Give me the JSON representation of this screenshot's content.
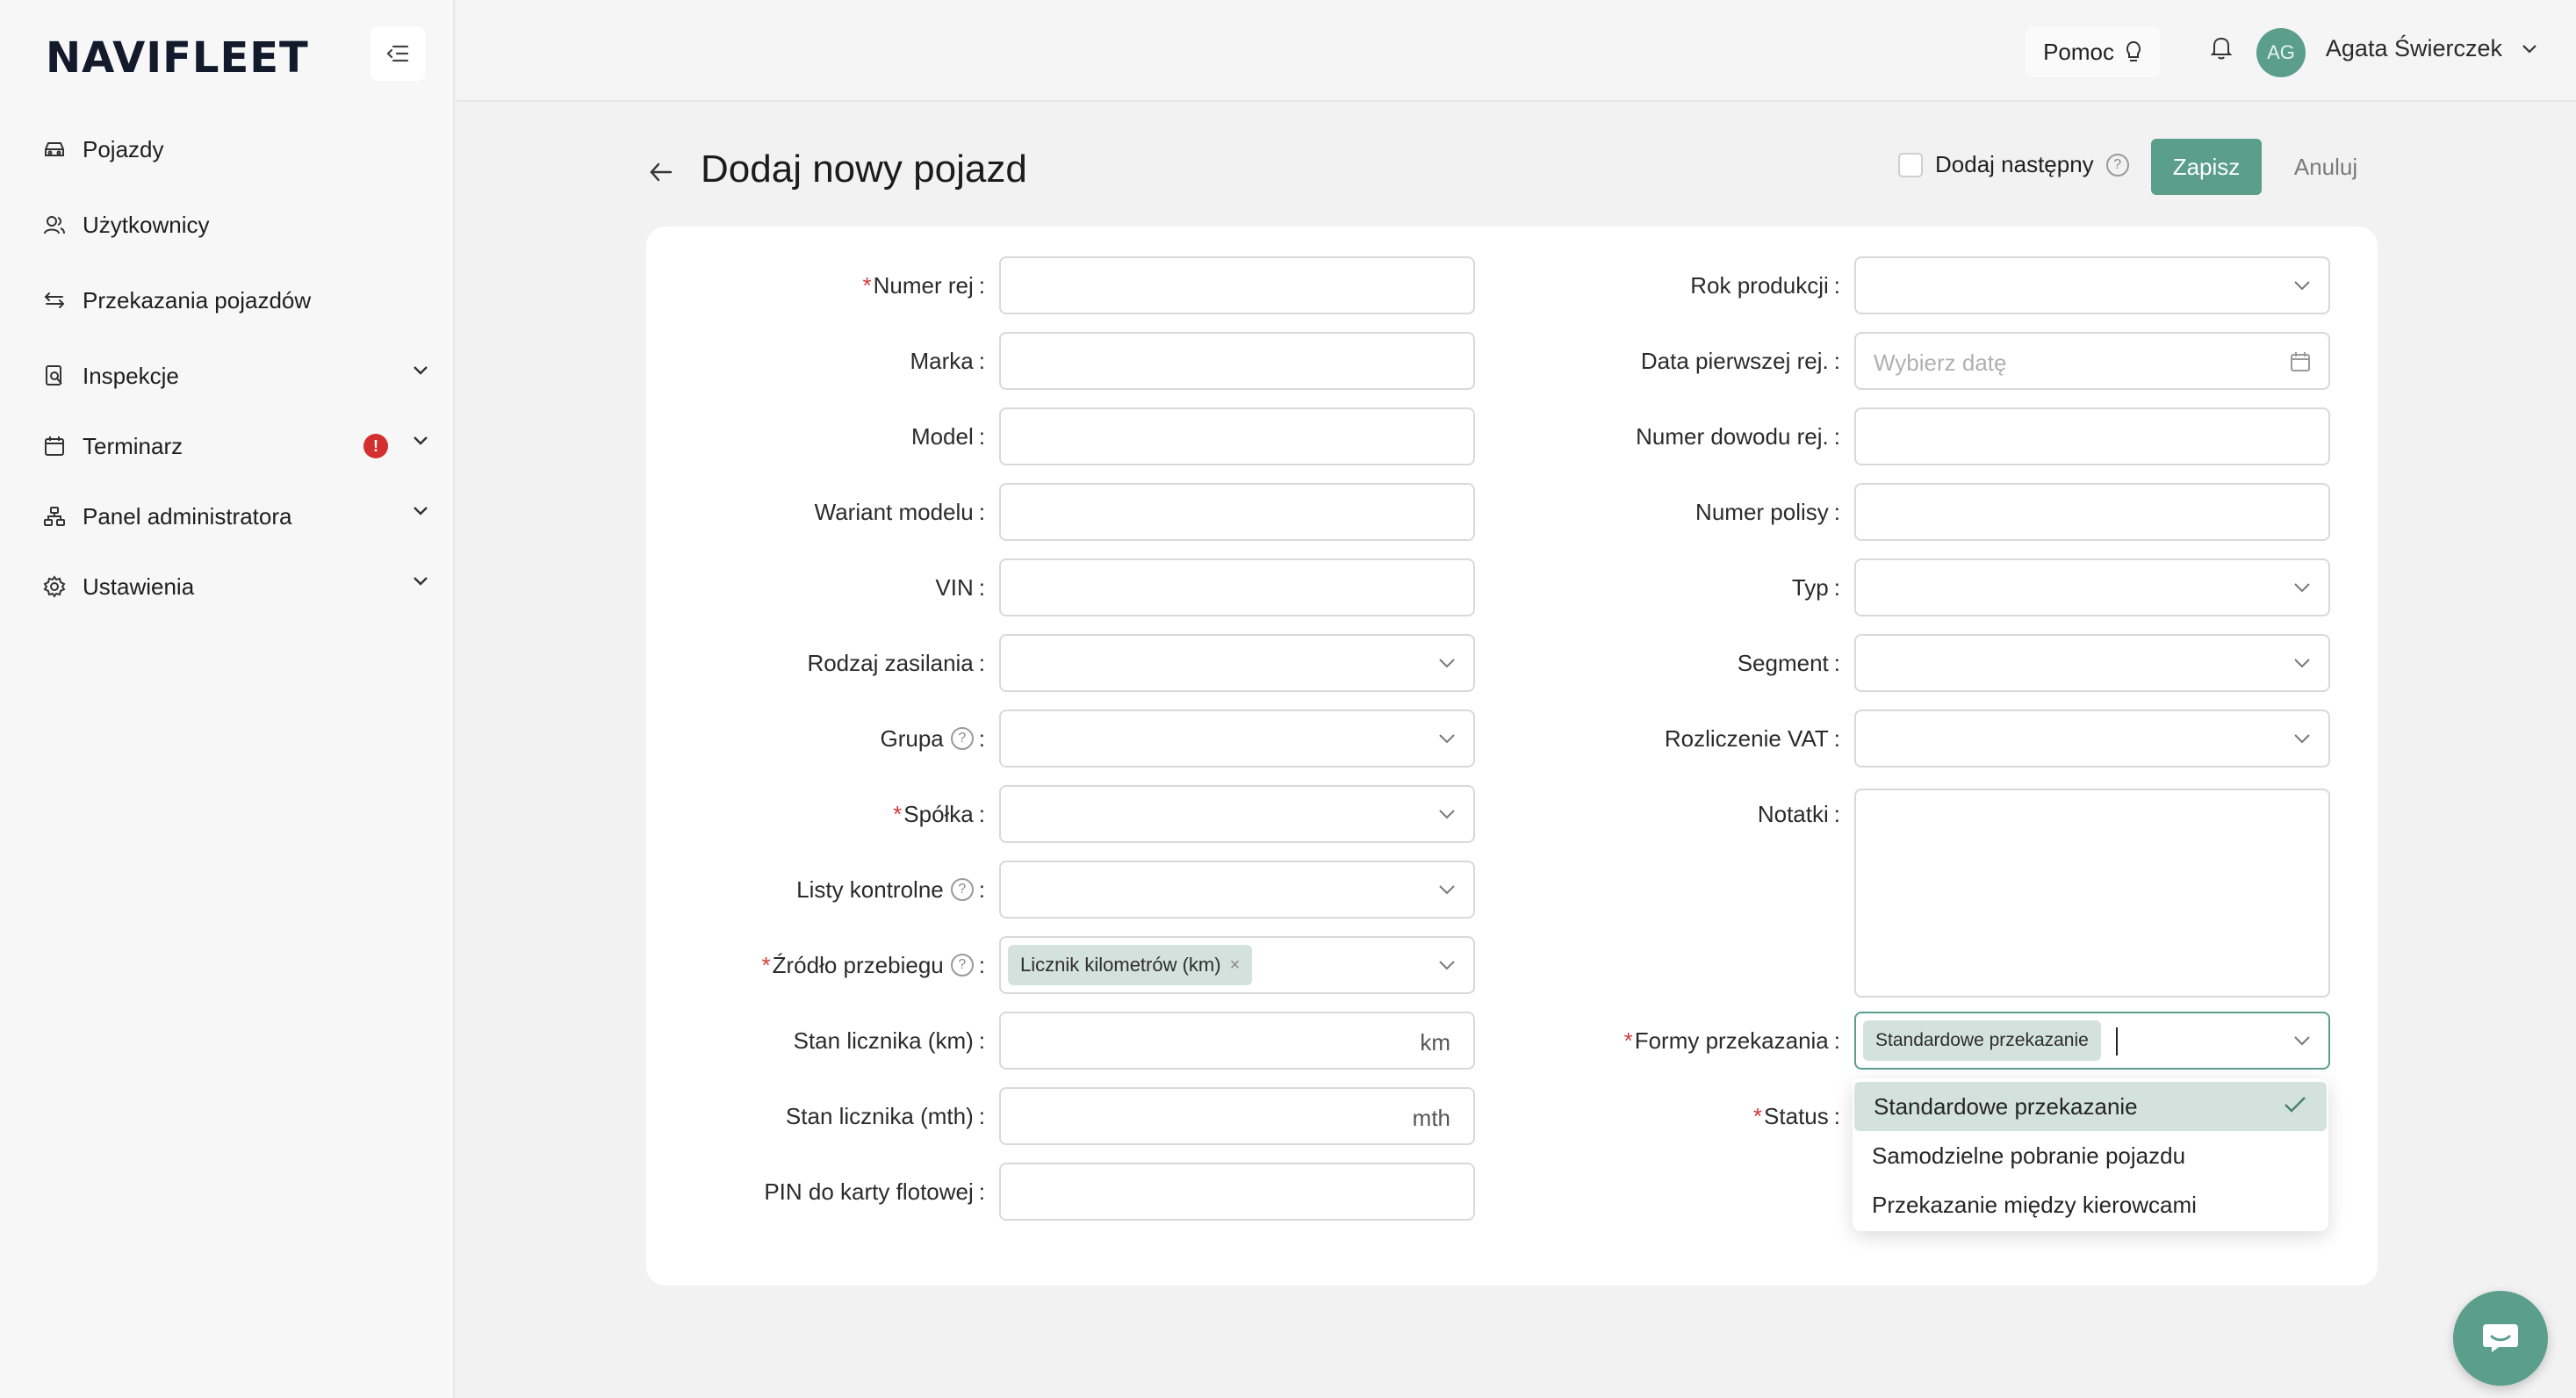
{
  "app": {
    "logo": "NAVIFLEET"
  },
  "sidebar": {
    "items": [
      {
        "label": "Pojazdy",
        "icon": "car-icon"
      },
      {
        "label": "Użytkownicy",
        "icon": "users-icon"
      },
      {
        "label": "Przekazania pojazdów",
        "icon": "swap-icon"
      },
      {
        "label": "Inspekcje",
        "icon": "inspection-icon",
        "expandable": true
      },
      {
        "label": "Terminarz",
        "icon": "calendar-icon",
        "expandable": true,
        "alert": "!"
      },
      {
        "label": "Panel administratora",
        "icon": "org-chart-icon",
        "expandable": true
      },
      {
        "label": "Ustawienia",
        "icon": "gear-icon",
        "expandable": true
      }
    ]
  },
  "topbar": {
    "help_label": "Pomoc",
    "avatar_initials": "AG",
    "user_name": "Agata Świerczek"
  },
  "header": {
    "title": "Dodaj nowy pojazd",
    "add_next_label": "Dodaj następny",
    "save_label": "Zapisz",
    "cancel_label": "Anuluj"
  },
  "form": {
    "left": [
      {
        "label": "Numer rej",
        "required": true,
        "type": "text"
      },
      {
        "label": "Marka",
        "type": "text"
      },
      {
        "label": "Model",
        "type": "text"
      },
      {
        "label": "Wariant modelu",
        "type": "text"
      },
      {
        "label": "VIN",
        "type": "text"
      },
      {
        "label": "Rodzaj zasilania",
        "type": "select"
      },
      {
        "label": "Grupa",
        "type": "select",
        "help": true
      },
      {
        "label": "Spółka",
        "required": true,
        "type": "select"
      },
      {
        "label": "Listy kontrolne",
        "type": "select",
        "help": true
      },
      {
        "label": "Źródło przebiegu",
        "required": true,
        "type": "select",
        "help": true,
        "tag": "Licznik kilometrów (km)"
      },
      {
        "label": "Stan licznika (km)",
        "type": "text",
        "suffix": "km"
      },
      {
        "label": "Stan licznika (mth)",
        "type": "text",
        "suffix": "mth"
      },
      {
        "label": "PIN do karty flotowej",
        "type": "text"
      }
    ],
    "right": [
      {
        "label": "Rok produkcji",
        "type": "select"
      },
      {
        "label": "Data pierwszej rej.",
        "type": "date",
        "placeholder": "Wybierz datę"
      },
      {
        "label": "Numer dowodu rej.",
        "type": "text"
      },
      {
        "label": "Numer polisy",
        "type": "text"
      },
      {
        "label": "Typ",
        "type": "select"
      },
      {
        "label": "Segment",
        "type": "select"
      },
      {
        "label": "Rozliczenie VAT",
        "type": "select"
      },
      {
        "label": "Notatki",
        "type": "textarea"
      },
      {
        "label": "Formy przekazania",
        "required": true,
        "type": "select",
        "tag": "Standardowe przekazanie"
      },
      {
        "label": "Status",
        "required": true,
        "type": "select"
      }
    ],
    "colon": ":"
  },
  "dropdown": {
    "options": [
      {
        "label": "Standardowe przekazanie",
        "selected": true
      },
      {
        "label": "Samodzielne pobranie pojazdu",
        "selected": false
      },
      {
        "label": "Przekazanie między kierowcami",
        "selected": false
      }
    ]
  },
  "colors": {
    "accent": "#5a9e8b",
    "required": "#d23a3a",
    "tag_bg": "#d3e2dd",
    "alert": "#d32f2f"
  }
}
